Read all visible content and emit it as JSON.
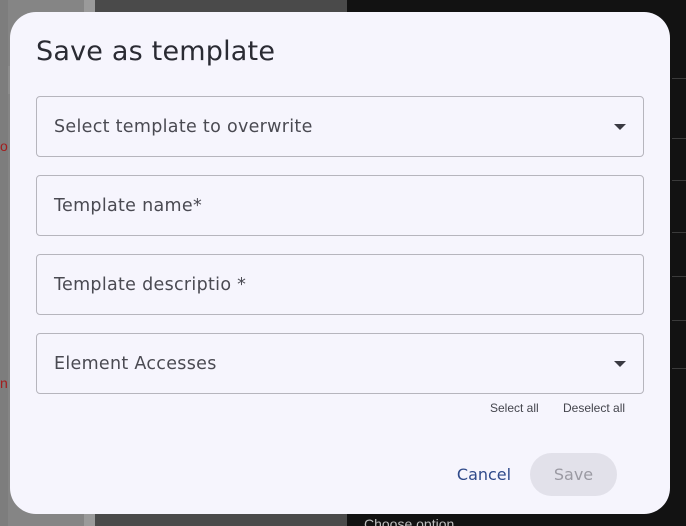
{
  "background": {
    "red_chars": [
      "o",
      "n"
    ],
    "choose_option": "Choose option"
  },
  "dialog": {
    "title": "Save as template",
    "fields": {
      "select_template": {
        "label": "Select template to overwrite",
        "type": "dropdown"
      },
      "template_name": {
        "label": "Template name*",
        "type": "text"
      },
      "template_description": {
        "label": "Template descriptio *",
        "type": "text"
      },
      "element_accesses": {
        "label": "Element Accesses",
        "type": "dropdown"
      }
    },
    "select_all": "Select all",
    "deselect_all": "Deselect all",
    "cancel_label": "Cancel",
    "save_label": "Save",
    "save_enabled": false
  },
  "colors": {
    "dialog_bg": "#f6f5fd",
    "cancel_text": "#2f4a8a",
    "save_disabled_bg": "#e2e1ea",
    "save_disabled_text": "#9b9aa3",
    "bg_red_text": "#a31d1d"
  },
  "icons": {
    "dropdown": "chevron-down-icon"
  }
}
